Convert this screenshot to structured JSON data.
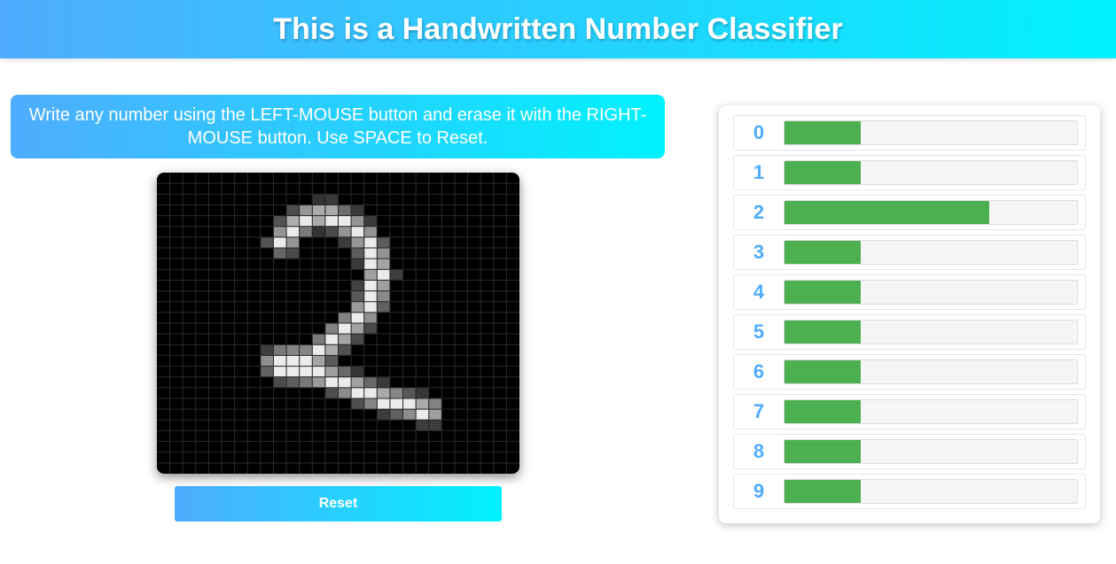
{
  "header": {
    "title": "This is a Handwritten Number Classifier"
  },
  "instructions": {
    "text": "Write any number using the LEFT-MOUSE button and erase it with the RIGHT-MOUSE button. Use SPACE to Reset."
  },
  "canvas": {
    "drawn_digit": "2",
    "grid_columns": 28,
    "grid_rows": 28
  },
  "reset_button": {
    "label": "Reset"
  },
  "predictions": [
    {
      "digit": "0",
      "level": 0.26
    },
    {
      "digit": "1",
      "level": 0.26
    },
    {
      "digit": "2",
      "level": 0.7
    },
    {
      "digit": "3",
      "level": 0.26
    },
    {
      "digit": "4",
      "level": 0.26
    },
    {
      "digit": "5",
      "level": 0.26
    },
    {
      "digit": "6",
      "level": 0.26
    },
    {
      "digit": "7",
      "level": 0.26
    },
    {
      "digit": "8",
      "level": 0.26
    },
    {
      "digit": "9",
      "level": 0.26
    }
  ],
  "colors": {
    "accent_start": "#4facfe",
    "accent_end": "#00f2fe",
    "bar_fill": "#4caf50",
    "digit_label": "#4facfe"
  }
}
